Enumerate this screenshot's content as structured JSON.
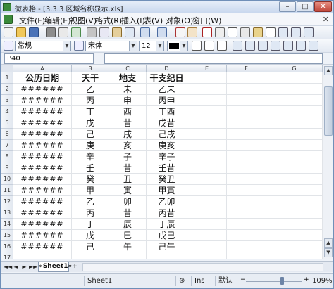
{
  "window": {
    "title": "微表格 - [3.3.3 区域名称显示.xls]",
    "min": "–",
    "max": "□",
    "close": "✕"
  },
  "menu": [
    "文件(F)",
    "编辑(E)",
    "视图(V)",
    "格式(R)",
    "插入(I)",
    "表(V)",
    "对象(O)",
    "窗口(W)"
  ],
  "menu_close": "✕",
  "toolbar2": {
    "style": "常规",
    "font": "宋体",
    "size": "12"
  },
  "namebox": "P40",
  "columns": [
    "A",
    "B",
    "C",
    "D",
    "E",
    "F",
    "G"
  ],
  "rows": [
    [
      "公历日期",
      "天干",
      "地支",
      "干支纪日"
    ],
    [
      "######",
      "乙",
      "未",
      "乙未"
    ],
    [
      "######",
      "丙",
      "申",
      "丙申"
    ],
    [
      "######",
      "丁",
      "酉",
      "丁酉"
    ],
    [
      "######",
      "戊",
      "昔",
      "戊昔"
    ],
    [
      "######",
      "己",
      "戌",
      "己戌"
    ],
    [
      "######",
      "庚",
      "亥",
      "庚亥"
    ],
    [
      "######",
      "辛",
      "子",
      "辛子"
    ],
    [
      "######",
      "壬",
      "昔",
      "壬昔"
    ],
    [
      "######",
      "癸",
      "丑",
      "癸丑"
    ],
    [
      "######",
      "甲",
      "寅",
      "甲寅"
    ],
    [
      "######",
      "乙",
      "卯",
      "乙卯"
    ],
    [
      "######",
      "丙",
      "昔",
      "丙昔"
    ],
    [
      "######",
      "丁",
      "辰",
      "丁辰"
    ],
    [
      "######",
      "戊",
      "巳",
      "戊巳"
    ],
    [
      "######",
      "己",
      "午",
      "己午"
    ]
  ],
  "sheet_tab": "«Sheet1»",
  "new_tab": "+",
  "nav": [
    "◄◄",
    "◄",
    "►",
    "►►"
  ],
  "status": {
    "sheet": "Sheet1",
    "mode": "Ins",
    "dropdown": "默认",
    "zoom": "109%"
  },
  "colors": {
    "title_bg": "#c9d8ee",
    "grid_line": "#e1e4e8",
    "header_bg": "#dfe5ee"
  }
}
